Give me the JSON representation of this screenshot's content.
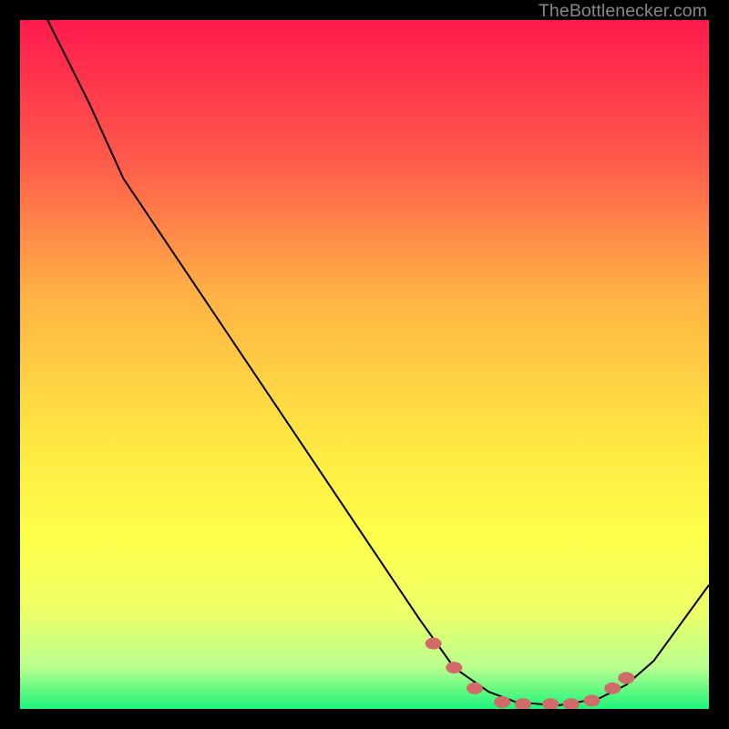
{
  "watermark": "TheBottlenecker.com",
  "chart_data": {
    "type": "line",
    "title": "",
    "xlabel": "",
    "ylabel": "",
    "xlim": [
      0,
      100
    ],
    "ylim": [
      0,
      100
    ],
    "background": {
      "type": "vertical-gradient",
      "stops": [
        {
          "offset": 0,
          "color": "#ff1a4d"
        },
        {
          "offset": 20,
          "color": "#ff594c"
        },
        {
          "offset": 40,
          "color": "#ffb245"
        },
        {
          "offset": 60,
          "color": "#ffe542"
        },
        {
          "offset": 75,
          "color": "#feff4a"
        },
        {
          "offset": 86,
          "color": "#edff69"
        },
        {
          "offset": 94,
          "color": "#b8ff8e"
        },
        {
          "offset": 100,
          "color": "#1cf57a"
        }
      ]
    },
    "series": [
      {
        "name": "curve",
        "type": "line",
        "color": "#000000",
        "points": [
          {
            "x": 4,
            "y": 100
          },
          {
            "x": 10,
            "y": 88
          },
          {
            "x": 15,
            "y": 77
          },
          {
            "x": 58,
            "y": 13
          },
          {
            "x": 63,
            "y": 6
          },
          {
            "x": 68,
            "y": 2.5
          },
          {
            "x": 72,
            "y": 1
          },
          {
            "x": 78,
            "y": 0.5
          },
          {
            "x": 84,
            "y": 1.5
          },
          {
            "x": 88,
            "y": 3.5
          },
          {
            "x": 92,
            "y": 7
          },
          {
            "x": 100,
            "y": 18
          }
        ]
      },
      {
        "name": "markers",
        "type": "scatter",
        "color": "#d36a6a",
        "shape": "ellipse",
        "points": [
          {
            "x": 60,
            "y": 9.5
          },
          {
            "x": 63,
            "y": 6
          },
          {
            "x": 66,
            "y": 3
          },
          {
            "x": 70,
            "y": 1
          },
          {
            "x": 73,
            "y": 0.7
          },
          {
            "x": 77,
            "y": 0.7
          },
          {
            "x": 80,
            "y": 0.7
          },
          {
            "x": 83,
            "y": 1.2
          },
          {
            "x": 86,
            "y": 3
          },
          {
            "x": 88,
            "y": 4.5
          }
        ]
      }
    ]
  }
}
